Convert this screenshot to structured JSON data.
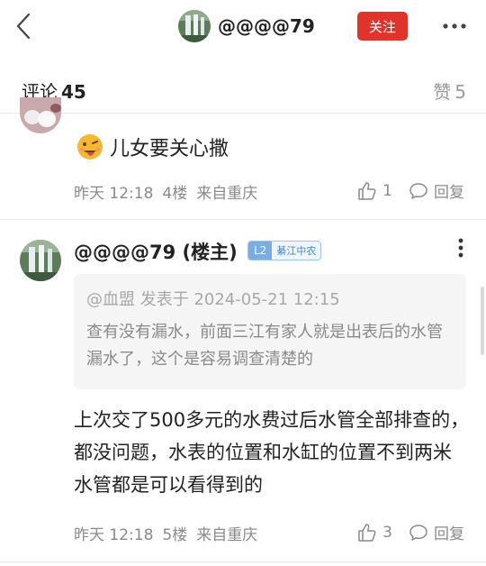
{
  "header": {
    "username": "@@@@79",
    "follow_label": "关注",
    "colors": {
      "follow_bg": "#e0332b"
    }
  },
  "tabs": {
    "comments_label": "评论",
    "comments_count": "45",
    "likes_label": "赞",
    "likes_count": "5"
  },
  "comments": [
    {
      "text": "儿女要关心撒",
      "time": "昨天 12:18",
      "floor": "4楼",
      "location": "来自重庆",
      "like_count": "1",
      "reply_label": "回复"
    },
    {
      "author": "@@@@79 (楼主)",
      "level": "L2",
      "group": "綦江中农",
      "quote_author": "@血盟 发表于 2024-05-21 12:15",
      "quote_text": "查有没有漏水，前面三江有家人就是出表后的水管漏水了，这个是容易调查清楚的",
      "text": "上次交了500多元的水费过后水管全部排查的，都没问题，水表的位置和水缸的位置不到两米水管都是可以看得到的",
      "time": "昨天 12:18",
      "floor": "5楼",
      "location": "来自重庆",
      "like_count": "3",
      "reply_label": "回复"
    }
  ]
}
